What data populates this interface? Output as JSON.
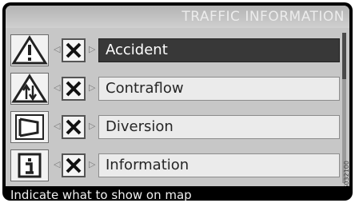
{
  "header": {
    "title": "TRAFFIC INFORMATION"
  },
  "items": [
    {
      "label": "Accident",
      "icon": "warning-triangle-icon",
      "checked": true,
      "selected": true
    },
    {
      "label": "Contraflow",
      "icon": "contraflow-icon",
      "checked": true,
      "selected": false
    },
    {
      "label": "Diversion",
      "icon": "diversion-icon",
      "checked": true,
      "selected": false
    },
    {
      "label": "Information",
      "icon": "info-icon",
      "checked": true,
      "selected": false
    }
  ],
  "status": {
    "text": "Indicate what to show on map"
  },
  "figure_code": "G032100",
  "colors": {
    "screen_bg": "#c7c7c7",
    "selected_bg": "#383838",
    "frame": "#000000"
  }
}
